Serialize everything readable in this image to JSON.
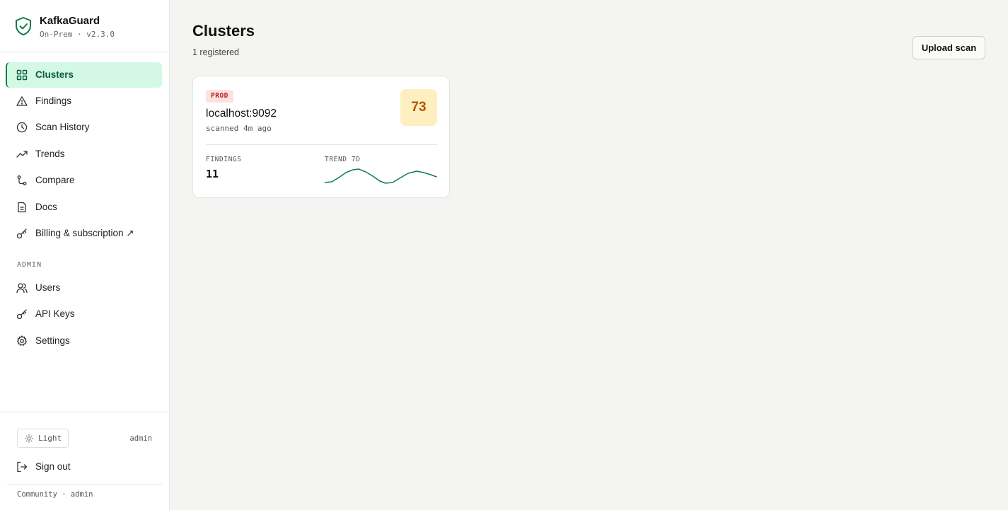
{
  "app": {
    "name": "KafkaGuard",
    "edition": "On-Prem · v2.3.0"
  },
  "sidebar": {
    "items": [
      {
        "label": "Clusters",
        "icon": "grid-icon",
        "active": true
      },
      {
        "label": "Findings",
        "icon": "warning-triangle-icon"
      },
      {
        "label": "Scan History",
        "icon": "clock-icon"
      },
      {
        "label": "Trends",
        "icon": "trending-up-icon"
      },
      {
        "label": "Compare",
        "icon": "git-compare-icon"
      },
      {
        "label": "Docs",
        "icon": "document-icon"
      },
      {
        "label": "Billing & subscription ↗",
        "icon": "key-icon"
      }
    ],
    "admin_label": "ADMIN",
    "admin_items": [
      {
        "label": "Users",
        "icon": "users-icon"
      },
      {
        "label": "API Keys",
        "icon": "key-icon"
      },
      {
        "label": "Settings",
        "icon": "gear-icon"
      }
    ],
    "footer": {
      "theme_label": "Light",
      "user": "admin",
      "signout_label": "Sign out",
      "plan_text": "Community · admin"
    }
  },
  "main": {
    "title": "Clusters",
    "subtitle": "1 registered",
    "upload_label": "Upload scan"
  },
  "clusters": [
    {
      "env": "PROD",
      "name": "localhost:9092",
      "scanned": "scanned 4m ago",
      "score": "73",
      "findings_label": "FINDINGS",
      "findings": "11",
      "trend_label": "TREND 7D"
    }
  ],
  "colors": {
    "accent": "#0f7b4e",
    "active_bg": "#d3f8e3",
    "prod_badge_bg": "#fde1e1",
    "prod_badge_text": "#b91c1c",
    "score_bg": "#fdefbf",
    "score_text": "#b45309"
  }
}
